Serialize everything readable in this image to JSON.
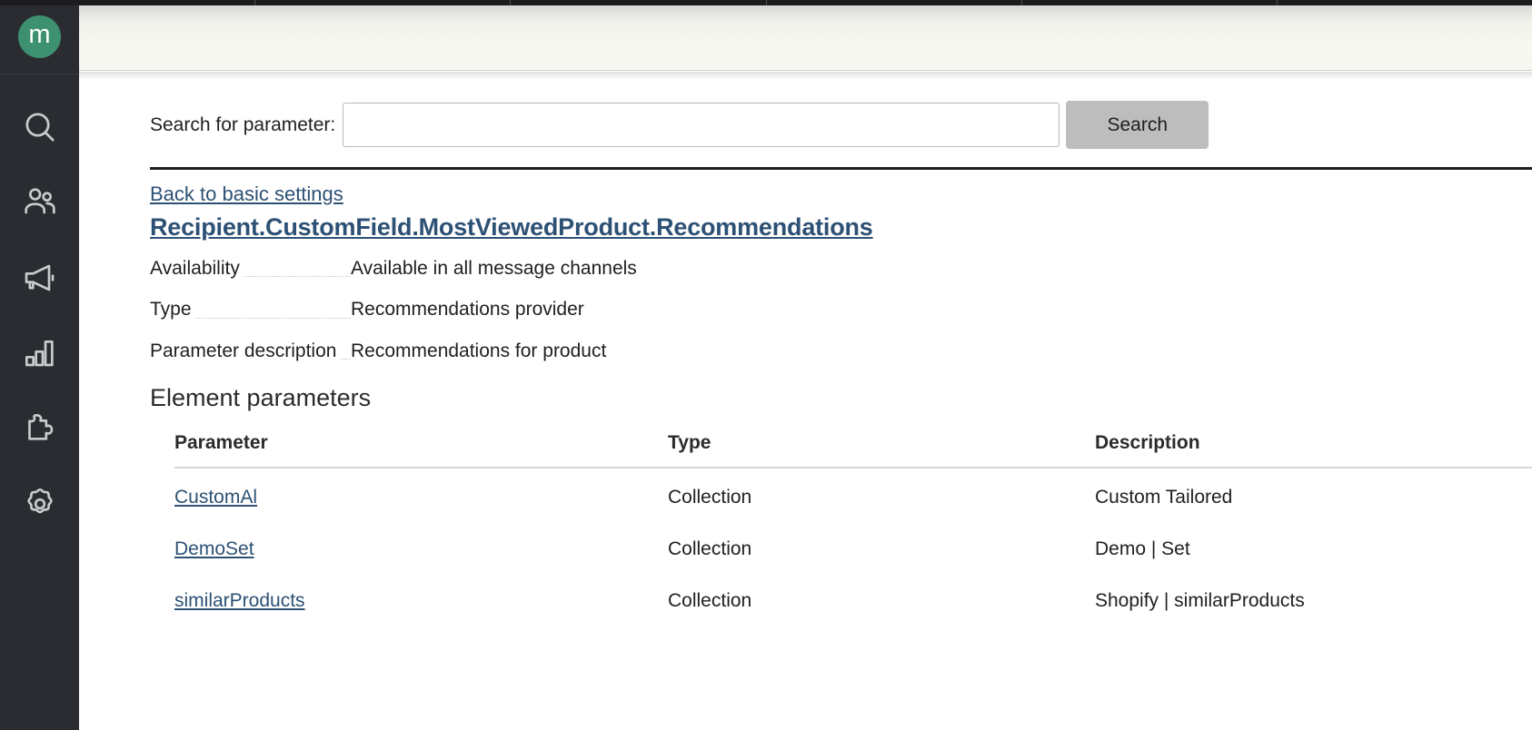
{
  "browser": {
    "tab_separator_count": 5
  },
  "sidebar": {
    "brand": {
      "logo_letter": "m",
      "logo_color": "#3d9171"
    },
    "background_color": "#2a2c31",
    "items": [
      {
        "name": "search-icon",
        "label": "Search"
      },
      {
        "name": "audience-icon",
        "label": "Audience"
      },
      {
        "name": "campaigns-icon",
        "label": "Campaigns"
      },
      {
        "name": "analytics-icon",
        "label": "Analytics"
      },
      {
        "name": "integrations-icon",
        "label": "Integrations"
      },
      {
        "name": "settings-icon",
        "label": "Settings"
      }
    ]
  },
  "search": {
    "label": "Search for parameter:",
    "value": "",
    "placeholder": "",
    "button_label": "Search"
  },
  "breadcrumb": {
    "back_label": "Back to basic settings",
    "title": "Recipient.CustomField.MostViewedProduct.Recommendations",
    "link_color": "#2d5175"
  },
  "meta": {
    "rows": [
      {
        "label": "Availability",
        "value": "Available in all message channels"
      },
      {
        "label": "Type",
        "value": "Recommendations provider"
      },
      {
        "label": "Parameter description",
        "value": "Recommendations for product"
      }
    ]
  },
  "section": {
    "heading": "Element parameters"
  },
  "table": {
    "columns": [
      "Parameter",
      "Type",
      "Description"
    ],
    "rows": [
      {
        "parameter": "CustomAl",
        "type": "Collection",
        "description": "Custom Tailored"
      },
      {
        "parameter": "DemoSet",
        "type": "Collection",
        "description": "Demo | Set"
      },
      {
        "parameter": "similarProducts",
        "type": "Collection",
        "description": "Shopify | similarProducts"
      }
    ]
  }
}
